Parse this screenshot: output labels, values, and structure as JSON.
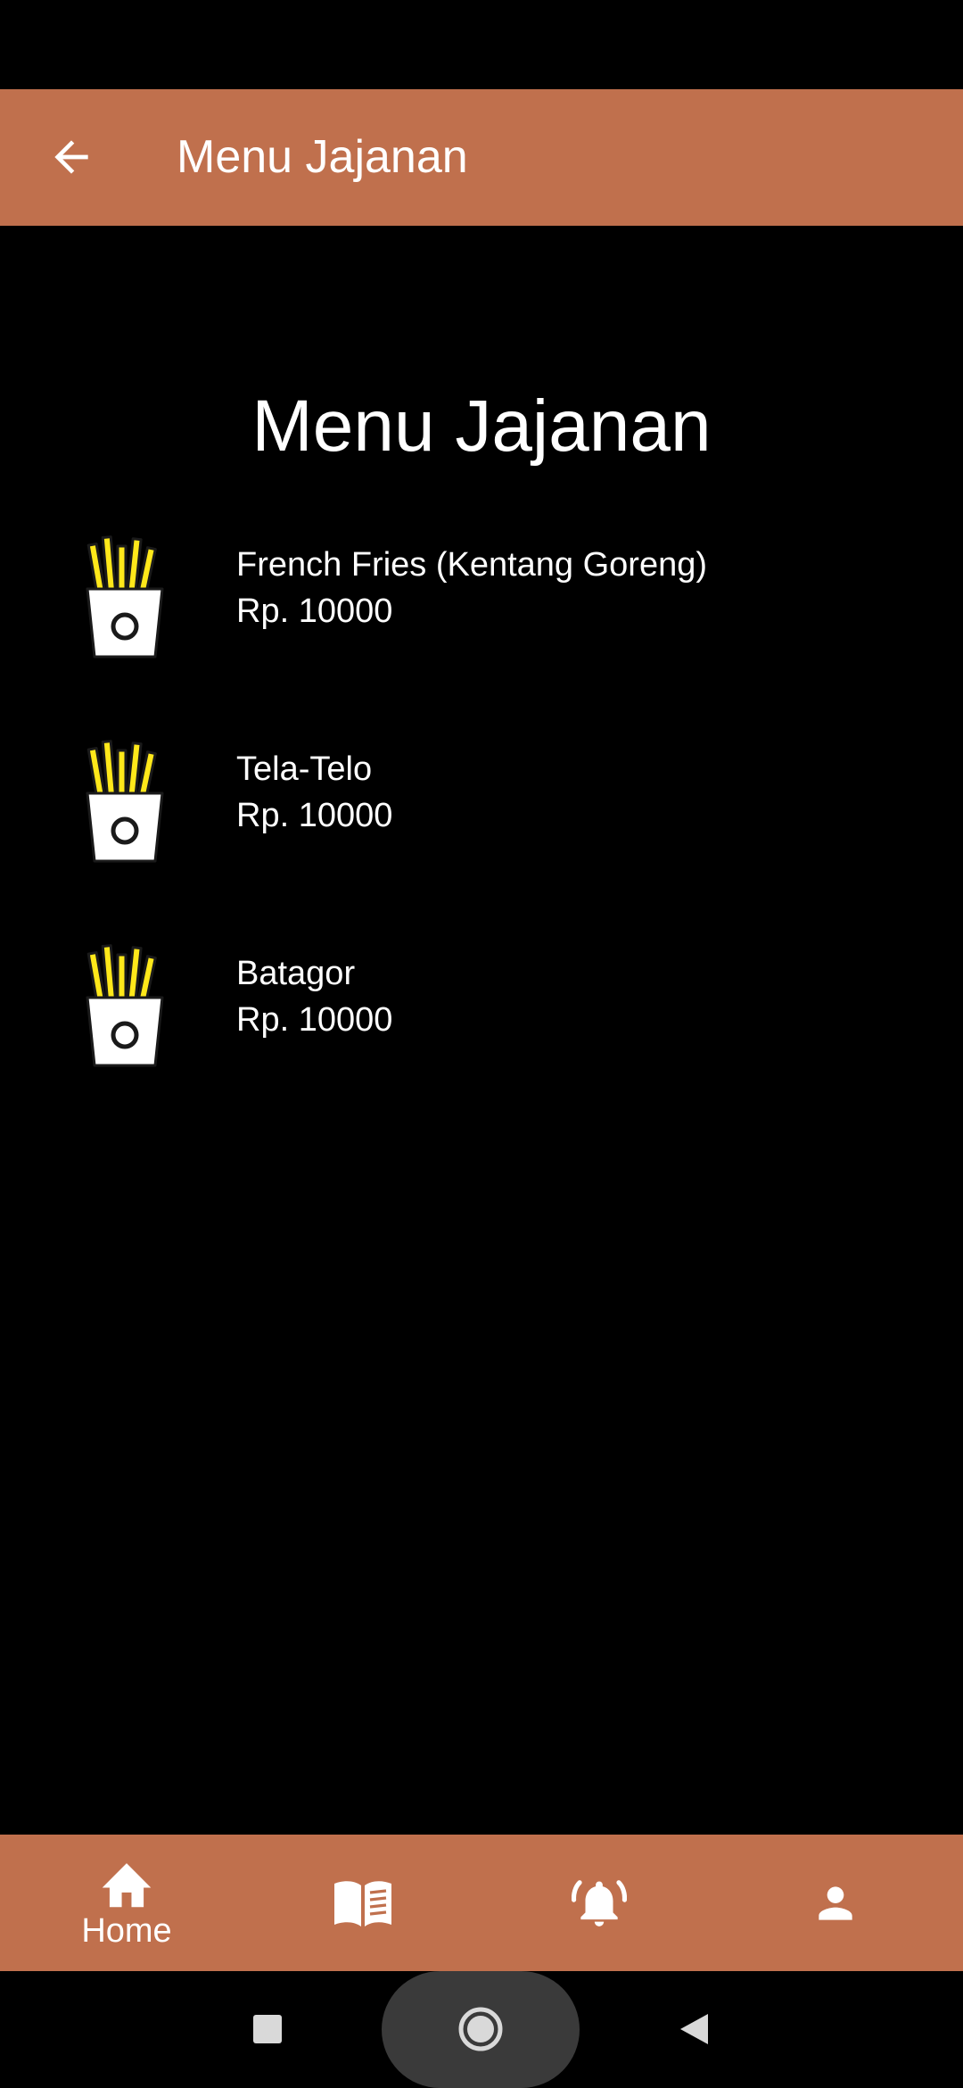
{
  "app_bar": {
    "title": "Menu Jajanan",
    "background": "#C0704D",
    "back_icon": "arrow-left-icon"
  },
  "page": {
    "heading": "Menu Jajanan"
  },
  "menu": {
    "items": [
      {
        "name": "French Fries (Kentang Goreng)",
        "price": "Rp. 10000",
        "icon": "french-fries-icon"
      },
      {
        "name": "Tela-Telo",
        "price": "Rp. 10000",
        "icon": "french-fries-icon"
      },
      {
        "name": "Batagor",
        "price": "Rp. 10000",
        "icon": "french-fries-icon"
      }
    ]
  },
  "bottom_nav": {
    "background": "#C0704D",
    "items": [
      {
        "label": "Home",
        "icon": "home-icon",
        "selected": true
      },
      {
        "label": "",
        "icon": "book-icon",
        "selected": false
      },
      {
        "label": "",
        "icon": "bell-icon",
        "selected": false
      },
      {
        "label": "",
        "icon": "person-icon",
        "selected": false
      }
    ]
  },
  "system_nav": {
    "buttons": [
      "recents-square-icon",
      "home-circle-icon",
      "back-triangle-icon"
    ]
  }
}
